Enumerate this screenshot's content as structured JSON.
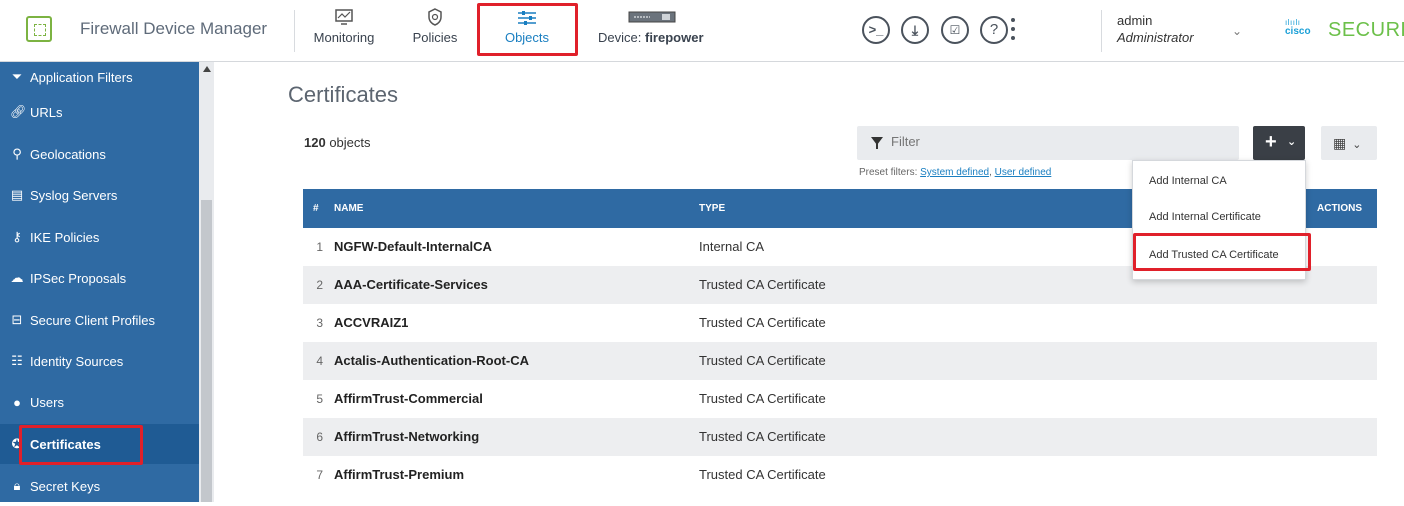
{
  "app": {
    "title": "Firewall Device Manager"
  },
  "nav": {
    "items": [
      {
        "label": "Monitoring",
        "icon": "monitoring-icon"
      },
      {
        "label": "Policies",
        "icon": "policies-icon"
      },
      {
        "label": "Objects",
        "icon": "objects-icon"
      }
    ],
    "device_label": "Device:",
    "device_name": "firepower"
  },
  "user": {
    "name": "admin",
    "role": "Administrator"
  },
  "brand": {
    "cisco": "cisco",
    "secure": "SECURE"
  },
  "sidebar": {
    "items": [
      {
        "label": "Application Filters",
        "icon": "filter-icon"
      },
      {
        "label": "URLs",
        "icon": "link-icon"
      },
      {
        "label": "Geolocations",
        "icon": "location-pin-icon"
      },
      {
        "label": "Syslog Servers",
        "icon": "server-icon"
      },
      {
        "label": "IKE Policies",
        "icon": "key-icon"
      },
      {
        "label": "IPSec Proposals",
        "icon": "cloud-lock-icon"
      },
      {
        "label": "Secure Client Profiles",
        "icon": "profile-icon"
      },
      {
        "label": "Identity Sources",
        "icon": "identity-icon"
      },
      {
        "label": "Users",
        "icon": "user-icon"
      },
      {
        "label": "Certificates",
        "icon": "certificate-icon"
      },
      {
        "label": "Secret Keys",
        "icon": "lock-icon"
      }
    ]
  },
  "page": {
    "title": "Certificates",
    "count": "120",
    "count_suffix": " objects",
    "filter_placeholder": "Filter",
    "preset_label": "Preset filters:",
    "preset_system": "System defined",
    "preset_sep": ",",
    "preset_user": "User defined"
  },
  "table": {
    "headers": {
      "num": "#",
      "name": "NAME",
      "type": "TYPE",
      "actions": "ACTIONS"
    },
    "rows": [
      {
        "num": "1",
        "name": "NGFW-Default-InternalCA",
        "type": "Internal CA"
      },
      {
        "num": "2",
        "name": "AAA-Certificate-Services",
        "type": "Trusted CA Certificate"
      },
      {
        "num": "3",
        "name": "ACCVRAIZ1",
        "type": "Trusted CA Certificate"
      },
      {
        "num": "4",
        "name": "Actalis-Authentication-Root-CA",
        "type": "Trusted CA Certificate"
      },
      {
        "num": "5",
        "name": "AffirmTrust-Commercial",
        "type": "Trusted CA Certificate"
      },
      {
        "num": "6",
        "name": "AffirmTrust-Networking",
        "type": "Trusted CA Certificate"
      },
      {
        "num": "7",
        "name": "AffirmTrust-Premium",
        "type": "Trusted CA Certificate"
      }
    ]
  },
  "add_menu": {
    "items": [
      "Add Internal CA",
      "Add Internal Certificate",
      "Add Trusted CA Certificate"
    ]
  },
  "colors": {
    "sidebar": "#2f6aa3",
    "accent": "#1a7fc1",
    "highlight": "#e0202a",
    "secure_green": "#6cc04a"
  }
}
